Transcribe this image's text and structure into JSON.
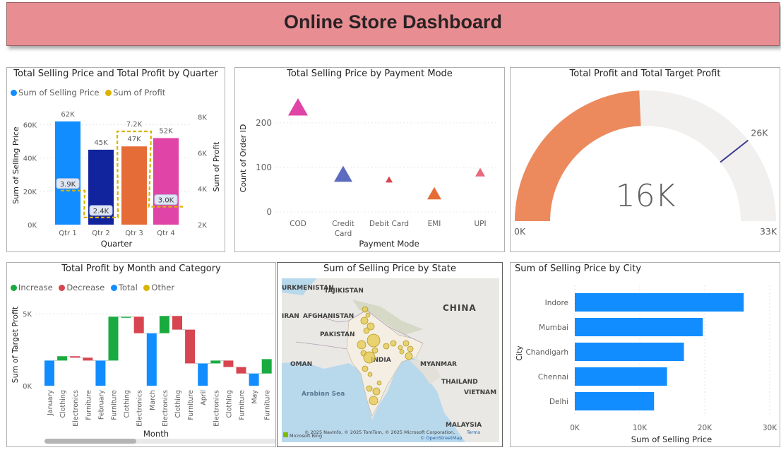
{
  "title": "Online Store Dashboard",
  "panels": {
    "quarter": {
      "title": "Total Selling Price and Total Profit by Quarter",
      "legend": [
        {
          "label": "Sum of Selling Price",
          "color": "#118dff"
        },
        {
          "label": "Sum of Profit",
          "color": "#d9b300"
        }
      ],
      "xlabel": "Quarter",
      "ylabel": "Sum of Selling Price",
      "y2label": "Sum of Profit"
    },
    "payment": {
      "title": "Total Selling Price by Payment Mode",
      "xlabel": "Payment Mode",
      "ylabel": "Count of Order ID"
    },
    "gauge": {
      "title": "Total Profit and Total Target Profit",
      "value_label": "16K",
      "min_label": "0K",
      "max_label": "33K",
      "target_label": "26K",
      "value": 16,
      "target": 26,
      "max": 33
    },
    "month": {
      "title": "Total Profit by Month and Category",
      "legend": [
        {
          "label": "Increase",
          "color": "#1aab40"
        },
        {
          "label": "Decrease",
          "color": "#d64550"
        },
        {
          "label": "Total",
          "color": "#118dff"
        },
        {
          "label": "Other",
          "color": "#d9b300"
        }
      ],
      "xlabel": "Month",
      "ylabel": "Sum of Target Profit"
    },
    "state": {
      "title": "Sum of Selling Price by State",
      "attribution": "© 2025 NavInfo, © 2025 TomTom, © 2025 Microsoft Corporation,",
      "terms": "Terms",
      "osm": "© OpenStreetMap",
      "bing": "Microsoft Bing",
      "labels": [
        "URKMENISTAN",
        "TAJIKISTAN",
        "IRAN",
        "AFGHANISTAN",
        "PAKISTAN",
        "CHINA",
        "OMAN",
        "INDIA",
        "MYANMAR",
        "THAILAND",
        "VIETNAM",
        "Arabian Sea",
        "MALAYSIA"
      ]
    },
    "city": {
      "title": "Sum of Selling Price by City",
      "xlabel": "Sum of Selling Price",
      "ylabel": "City"
    }
  },
  "chart_data": [
    {
      "type": "bar",
      "title": "Total Selling Price and Total Profit by Quarter",
      "categories": [
        "Qtr 1",
        "Qtr 2",
        "Qtr 3",
        "Qtr 4"
      ],
      "series": [
        {
          "name": "Sum of Selling Price",
          "values": [
            62000,
            45000,
            47000,
            52000
          ],
          "labels": [
            "62K",
            "45K",
            "47K",
            "52K"
          ],
          "colors": [
            "#118dff",
            "#12239e",
            "#e66c37",
            "#e044a7"
          ]
        },
        {
          "name": "Sum of Profit",
          "values": [
            3900,
            2400,
            7200,
            3000
          ],
          "labels": [
            "3.9K",
            "2.4K",
            "7.2K",
            "3.0K"
          ],
          "axis": "secondary"
        }
      ],
      "yticks": [
        "0K",
        "20K",
        "40K",
        "60K"
      ],
      "ylim": [
        0,
        70000
      ],
      "y2ticks": [
        "2K",
        "4K",
        "6K",
        "8K"
      ],
      "y2lim": [
        2000,
        8500
      ]
    },
    {
      "type": "scatter",
      "title": "Total Selling Price by Payment Mode",
      "categories": [
        "COD",
        "Credit Card",
        "Debit Card",
        "EMI",
        "UPI"
      ],
      "values": [
        233,
        83,
        72,
        40,
        88
      ],
      "colors": [
        "#e044a7",
        "#5c6bbf",
        "#d64550",
        "#e66c37",
        "#e66c7d"
      ],
      "yticks": [
        "0",
        "100",
        "200"
      ],
      "ylim": [
        0,
        260
      ]
    },
    {
      "type": "waterfall",
      "title": "Total Profit by Month and Category",
      "categories": [
        "January",
        "Clothing",
        "Electronics",
        "Furniture",
        "February",
        "Furniture",
        "Clothing",
        "Electronics",
        "March",
        "Electronics",
        "Clothing",
        "Furniture",
        "April",
        "Electronics",
        "Clothing",
        "Furniture",
        "May",
        "Furniture"
      ],
      "bars": [
        [
          0,
          1750,
          "total"
        ],
        [
          1750,
          2050,
          "increase"
        ],
        [
          2050,
          1950,
          "decrease"
        ],
        [
          1950,
          1750,
          "decrease"
        ],
        [
          0,
          1750,
          "total"
        ],
        [
          1750,
          4800,
          "increase"
        ],
        [
          4800,
          4800,
          "increase"
        ],
        [
          4800,
          3650,
          "decrease"
        ],
        [
          0,
          3650,
          "total"
        ],
        [
          3650,
          4850,
          "increase"
        ],
        [
          4850,
          3900,
          "decrease"
        ],
        [
          3900,
          1550,
          "decrease"
        ],
        [
          0,
          1550,
          "total"
        ],
        [
          1550,
          1750,
          "increase"
        ],
        [
          1750,
          1300,
          "decrease"
        ],
        [
          1300,
          850,
          "decrease"
        ],
        [
          0,
          850,
          "total"
        ],
        [
          850,
          1850,
          "increase"
        ]
      ],
      "yticks": [
        "0K",
        "5K"
      ],
      "ylim": [
        0,
        5600
      ]
    },
    {
      "type": "bar",
      "title": "Sum of Selling Price by City",
      "categories": [
        "Indore",
        "Mumbai",
        "Chandigarh",
        "Chennai",
        "Delhi"
      ],
      "values": [
        26000,
        19700,
        16800,
        14200,
        12200
      ],
      "xticks": [
        "0K",
        "10K",
        "20K",
        "30K"
      ],
      "xlim": [
        0,
        30000
      ]
    }
  ]
}
